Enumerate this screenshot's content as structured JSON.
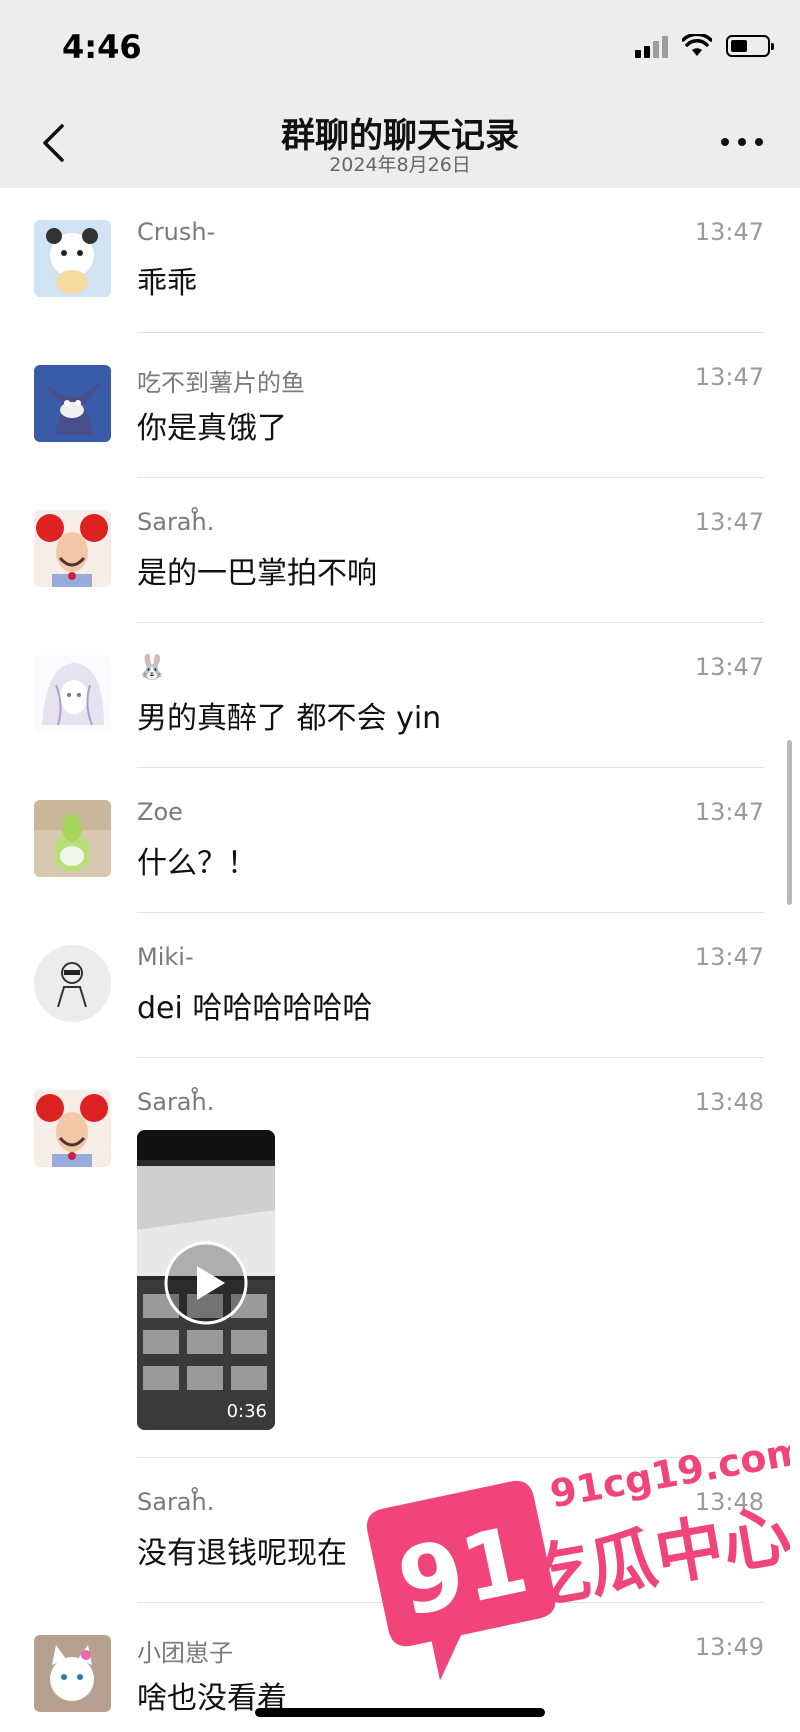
{
  "status_bar": {
    "time": "4:46"
  },
  "nav": {
    "title": "群聊的聊天记录",
    "subtitle": "2024年8月26日"
  },
  "messages": [
    {
      "sender": "Crush-",
      "time": "13:47",
      "text": "乖乖",
      "avatar": "panda-bear-avatar"
    },
    {
      "sender": "吃不到薯片的鱼",
      "time": "13:47",
      "text": "你是真饿了",
      "avatar": "cartoon-cat-avatar"
    },
    {
      "sender": "Sarah̊.",
      "time": "13:47",
      "text": "是的一巴掌拍不响",
      "avatar": "red-hair-avatar"
    },
    {
      "sender": "🐰",
      "time": "13:47",
      "text": "男的真醉了 都不会 yin",
      "avatar": "anime-girl-avatar"
    },
    {
      "sender": "Zoe",
      "time": "13:47",
      "text": "什么？！",
      "avatar": "green-toy-avatar"
    },
    {
      "sender": "Miki-",
      "time": "13:47",
      "text": "dei 哈哈哈哈哈哈",
      "avatar": "sketch-person-avatar"
    },
    {
      "sender": "Sarah̊.",
      "time": "13:48",
      "text": "",
      "avatar": "red-hair-avatar",
      "video_duration": "0:36"
    },
    {
      "sender": "Sarah̊.",
      "time": "13:48",
      "text": "没有退钱呢现在",
      "avatar": ""
    },
    {
      "sender": "小团崽子",
      "time": "13:49",
      "text": "啥也没看着",
      "avatar": "white-cat-avatar"
    }
  ],
  "watermark": {
    "number": "91",
    "site": "91cg19.com",
    "label": "吃瓜中心"
  }
}
